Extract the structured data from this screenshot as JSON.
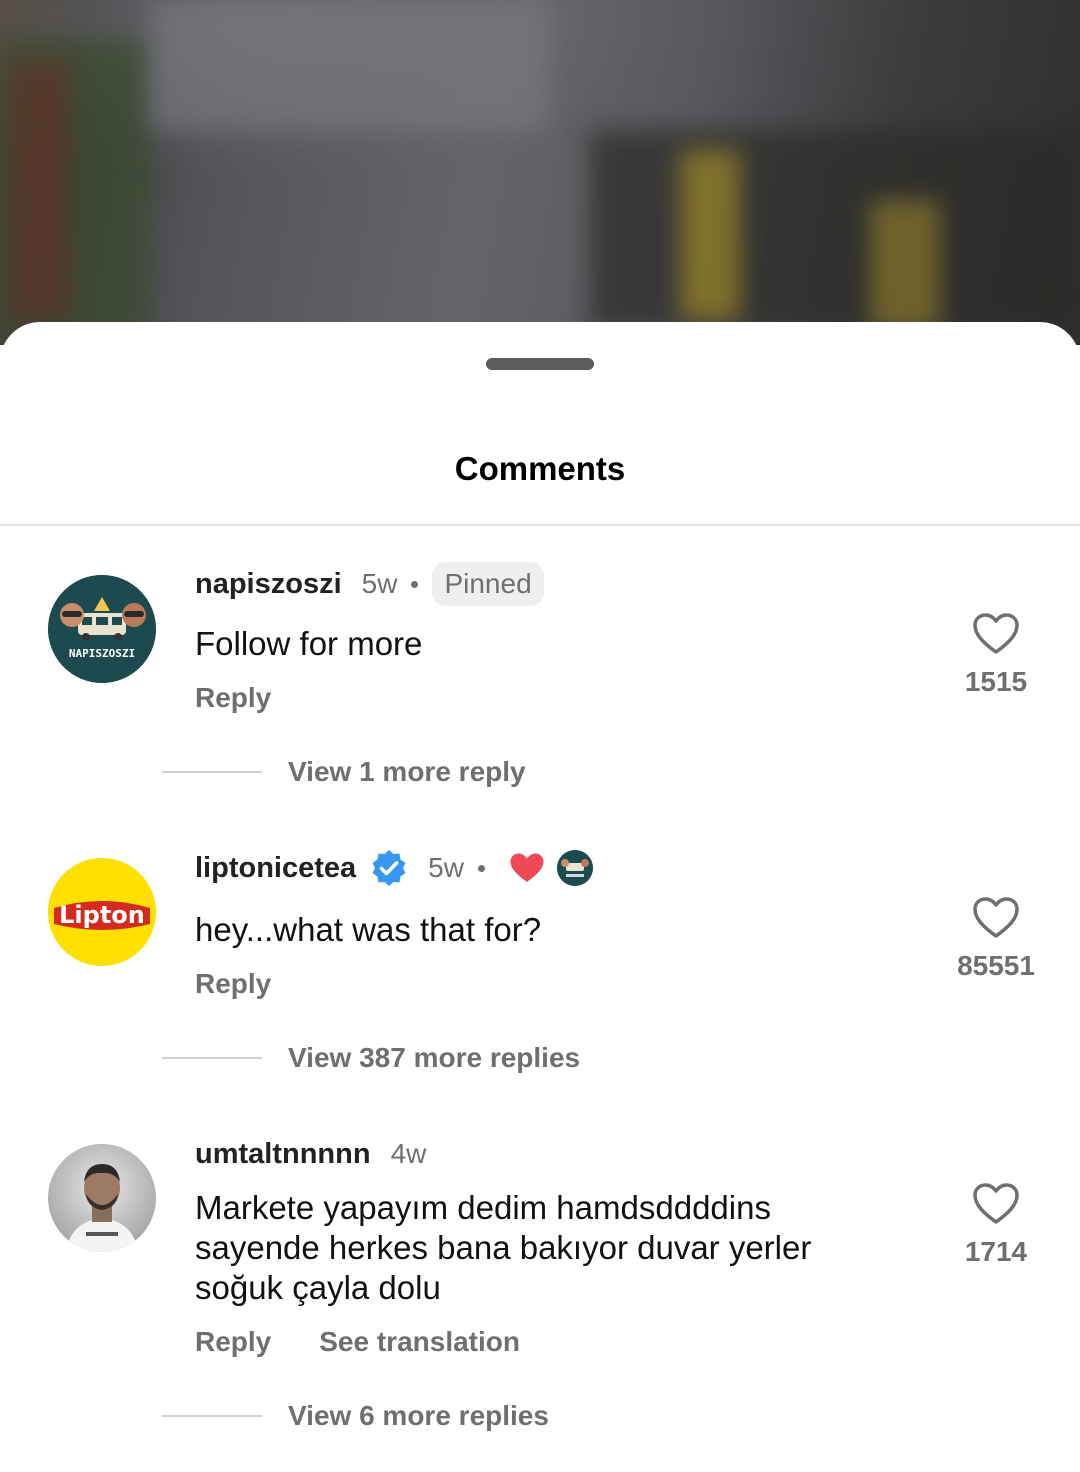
{
  "sheet": {
    "title": "Comments"
  },
  "comments": [
    {
      "username": "napiszoszi",
      "time": "5w",
      "badge": "Pinned",
      "text": "Follow for more",
      "reply_label": "Reply",
      "likes": "1515",
      "view_replies": "View 1 more reply",
      "avatar_text": "NAPISZOSZI"
    },
    {
      "username": "liptonicetea",
      "verified": true,
      "time": "5w",
      "text": "hey...what was that for?",
      "reply_label": "Reply",
      "likes": "85551",
      "view_replies": "View 387 more replies",
      "avatar_text": "Lipton",
      "liked_by_creator": true
    },
    {
      "username": "umtaltnnnnn",
      "time": "4w",
      "text": "Markete yapayım dedim hamdsddddins sayende herkes bana bakıyor duvar yerler soğuk çayla dolu",
      "reply_label": "Reply",
      "translation_label": "See translation",
      "likes": "1714",
      "view_replies": "View 6 more replies"
    }
  ],
  "colors": {
    "accent_verified": "#3897f0",
    "heart_red": "#ed4956",
    "secondary_text": "#6f6f6f",
    "lipton_yellow": "#ffe000",
    "lipton_red": "#d52b1e"
  },
  "icons": [
    "heart-outline-icon",
    "verified-badge-icon",
    "heart-filled-icon"
  ]
}
